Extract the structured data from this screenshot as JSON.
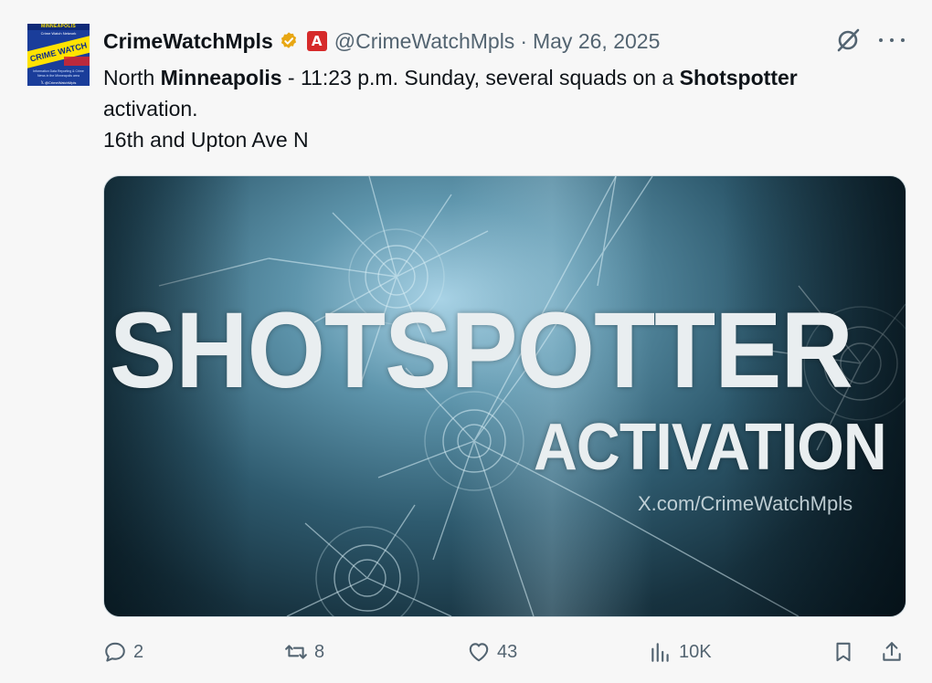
{
  "author": {
    "display_name": "CrimeWatchMpls",
    "handle": "@CrimeWatchMpls",
    "separator": "·",
    "date": "May 26, 2025",
    "verified_color": "#e8a713",
    "affiliate_badge": "A"
  },
  "avatar": {
    "top_text": "MINNEAPOLIS",
    "network_text": "Crime Watch Network",
    "band_text": "CRIME WATCH",
    "lines_text": "Information Data Reporting & Crime News in the Minneapolis area",
    "bottom_text": "𝕏 @CrimeWatchMpls"
  },
  "post": {
    "line1_a": "North ",
    "line1_b": "Minneapolis",
    "line1_c": " - 11:23 p.m. Sunday, several squads on a ",
    "line1_d": "Shotspotter",
    "line2": "activation.",
    "line3": "16th and Upton Ave N"
  },
  "media": {
    "headline": "SHOTSPOTTER",
    "subheadline": "ACTIVATION",
    "watermark": "X.com/CrimeWatchMpls"
  },
  "actions": {
    "replies": "2",
    "reposts": "8",
    "likes": "43",
    "views": "10K"
  },
  "icons": {
    "grok": "grok-icon",
    "more": "more-icon",
    "reply": "reply-icon",
    "repost": "repost-icon",
    "like": "heart-icon",
    "views": "views-icon",
    "bookmark": "bookmark-icon",
    "share": "share-icon"
  }
}
